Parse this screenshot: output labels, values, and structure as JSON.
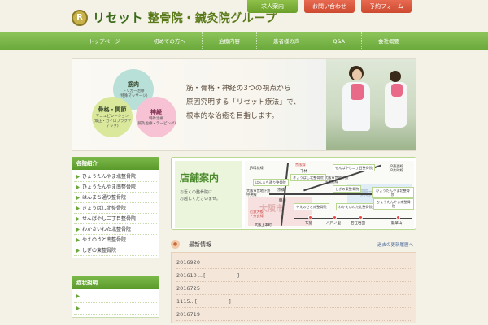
{
  "header": {
    "logo_mark": "R",
    "brand": "リセット",
    "subtitle": "整骨院・鍼灸院グループ",
    "buttons": {
      "recruit": "求人案内",
      "contact": "お問い合わせ",
      "reserve": "予約フォーム"
    }
  },
  "nav": [
    "トップページ",
    "初めての方へ",
    "治療内容",
    "患者様の声",
    "Q&A",
    "会社概要"
  ],
  "hero": {
    "circles": {
      "muscle": {
        "title": "筋肉",
        "desc": "トリガー治療\n(特殊マッサージ)"
      },
      "bone": {
        "title": "骨格・関節",
        "desc": "マニュピレーション\n(矯正・カイロプラクティック)"
      },
      "nerve": {
        "title": "神経",
        "desc": "特殊治療\n(鍼灸治療・テーピング)"
      }
    },
    "copy": [
      "筋・骨格・神経の3つの視点から",
      "原因究明する「リセット療法」で、",
      "根本的な治癒を目指します。"
    ]
  },
  "sidebar": {
    "clinics_title": "各院紹介",
    "clinics": [
      "ひょうたんやま北整骨院",
      "ひょうたんやま南整骨院",
      "はんまち通り整骨院",
      "きょうばし北整骨院",
      "せんばやし二丁目整骨院",
      "わかさいわた北整骨院",
      "やえのさと南整骨院",
      "しぎの東整骨院"
    ],
    "symptoms_title": "症状説明",
    "symptoms": [
      "",
      ""
    ]
  },
  "store": {
    "title": "店舗案内",
    "desc": "お近くの整骨院に\nお越しくださいませ。",
    "areas": {
      "osaka": "大阪市",
      "east": "東大阪市"
    },
    "labels": {
      "senbayashi": "せんばやし二丁目整骨院",
      "kyobashi": "きょうばし北整骨院",
      "hanmachi": "はんまち通り整骨院",
      "shigino": "しぎの東整骨院",
      "hyotan_n": "ひょうたんやま北整骨院",
      "hyotan_s": "ひょうたんやま南整骨院",
      "yaenosato": "やえのさと南整骨院",
      "wakae": "わかえいわた北整骨院",
      "jr_keihan": "JR環状線",
      "keihan": "京阪線",
      "sembayashi": "千林",
      "kyobashi_st": "京橋",
      "tsurumi": "鶴見",
      "osaka_sub": "大阪市営地下鉄\n今里筋線",
      "jr_higashi": "JR東西線\nJR片町線",
      "osaka_sub2": "大阪市営地下鉄\n中央線",
      "kintetsu": "近鉄大阪\n・奈良線",
      "osaka_uehon": "大阪上本町",
      "fuse": "布施",
      "yaenosato_st": "八戸ノ里",
      "wakaeiwata_st": "若江岩田",
      "hyotanyama_st": "瓢箪山"
    }
  },
  "news": {
    "title": "最新情報",
    "link": "過去の更新履歴へ",
    "items": [
      "2016920",
      "201610 ...[　　　　　　]",
      "2016725",
      "1115...[　　　　　　]",
      "2016719"
    ]
  },
  "colors": {
    "accent_green": "#6aa83a",
    "accent_red": "#cc4a30",
    "background": "#f4f1e6"
  }
}
